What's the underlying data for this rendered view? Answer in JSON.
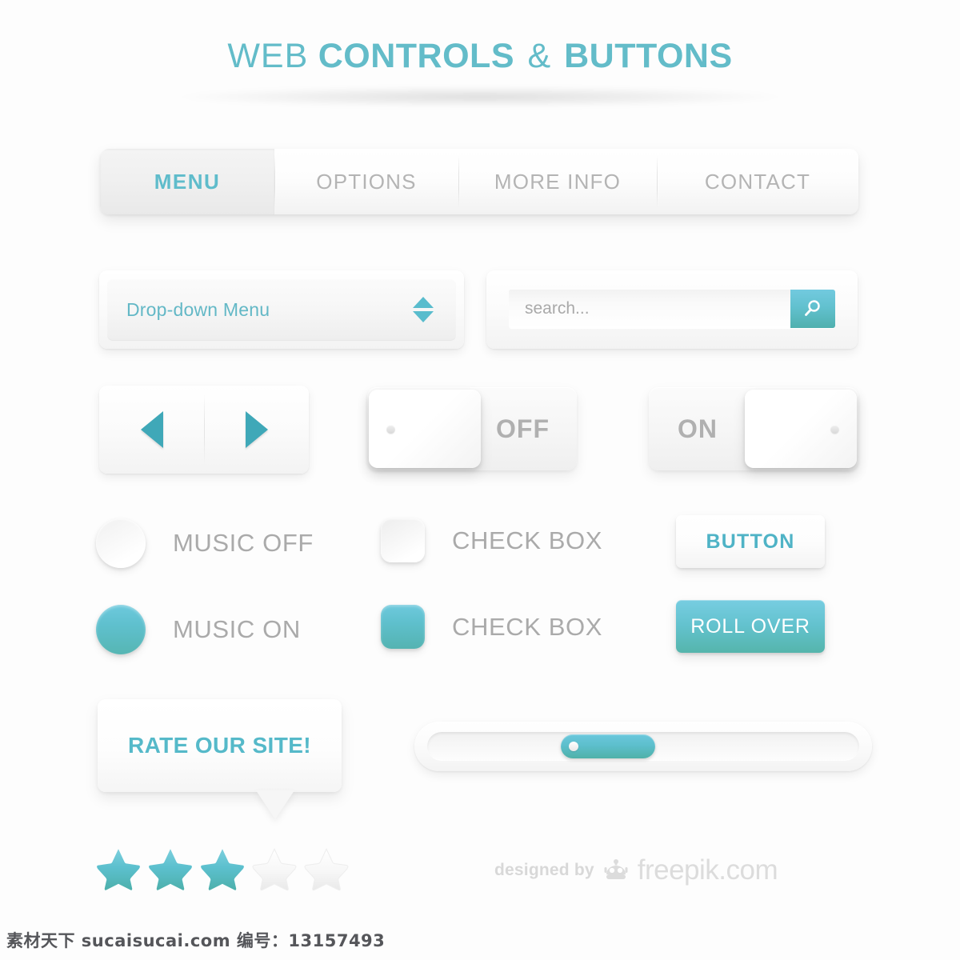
{
  "title": {
    "word1": "WEB",
    "word2": "CONTROLS",
    "amp": "&",
    "word3": "BUTTONS",
    "accent_color": "#63bcc9"
  },
  "navbar": {
    "items": [
      {
        "label": "MENU",
        "active": true
      },
      {
        "label": "OPTIONS",
        "active": false
      },
      {
        "label": "MORE INFO",
        "active": false
      },
      {
        "label": "CONTACT",
        "active": false
      }
    ]
  },
  "dropdown": {
    "label": "Drop-down Menu",
    "stepper_up_icon": "triangle-up-icon",
    "stepper_down_icon": "triangle-down-icon"
  },
  "search": {
    "value": "",
    "placeholder": "search...",
    "button_icon": "search-icon"
  },
  "arrows": {
    "prev_icon": "triangle-left-icon",
    "next_icon": "triangle-right-icon"
  },
  "toggles": [
    {
      "label": "OFF",
      "state": "off"
    },
    {
      "label": "ON",
      "state": "on"
    }
  ],
  "radios": [
    {
      "label": "MUSIC OFF",
      "checked": false
    },
    {
      "label": "MUSIC ON",
      "checked": true
    }
  ],
  "checkboxes": [
    {
      "label": "CHECK BOX",
      "checked": false
    },
    {
      "label": "CHECK BOX",
      "checked": true
    }
  ],
  "buttons": {
    "normal": "BUTTON",
    "rollover": "ROLL OVER"
  },
  "bubble": {
    "text": "RATE OUR SITE!"
  },
  "slider": {
    "position_percent": 30
  },
  "rating": {
    "filled": 3,
    "total": 5,
    "filled_color": "#5cc0ce",
    "empty_color": "#f2f2f2"
  },
  "credit": {
    "designed_by": "designed by",
    "brand": "freepik.com",
    "logo_icon": "freepik-robot-icon"
  },
  "watermark": {
    "text": "素材天下 sucaisucai.com  编号：13157493"
  },
  "theme": {
    "accent": "#5cc0ce",
    "accent_dark": "#4fb0ae",
    "text_gray": "#aaaaaa",
    "background": "#fdfdfd"
  }
}
